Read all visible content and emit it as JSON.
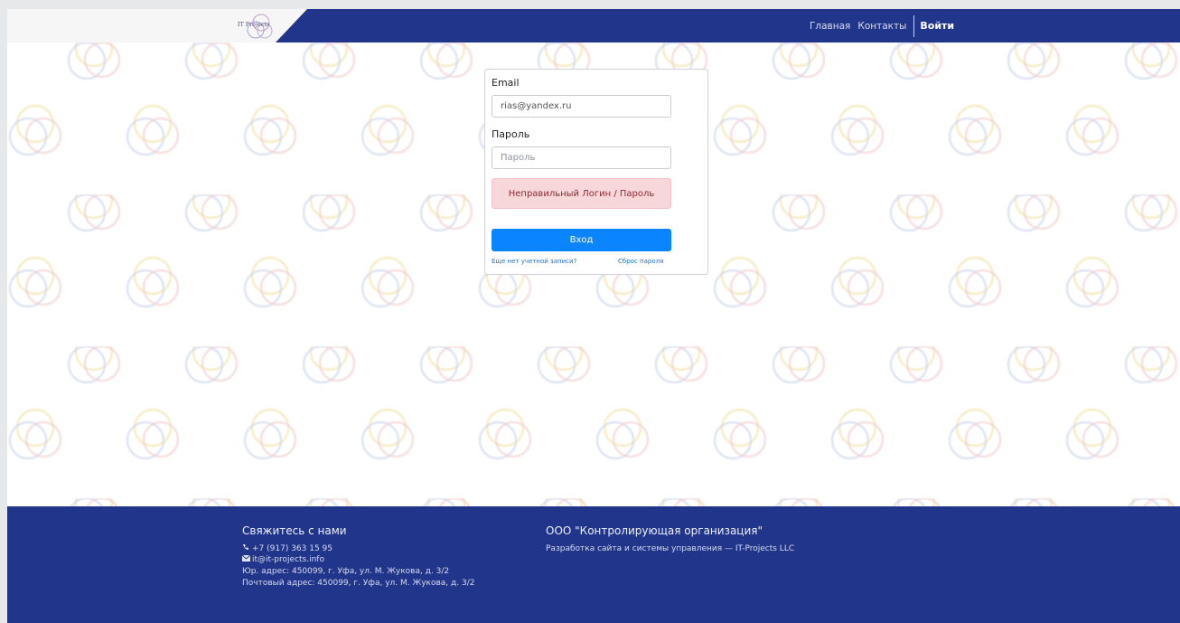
{
  "header": {
    "logo_text": "IT Projects",
    "nav": {
      "home": "Главная",
      "contacts": "Контакты",
      "login": "Войти"
    }
  },
  "login_form": {
    "email_label": "Email",
    "email_value": "rias@yandex.ru",
    "password_label": "Пароль",
    "password_placeholder": "Пароль",
    "error_message": "Неправильный Логин / Пароль",
    "submit_label": "Вход",
    "register_link": "Еще нет учетной записи?",
    "reset_link": "Сброс пароля"
  },
  "footer": {
    "contact_title": "Свяжитесь с нами",
    "phone": "+7 (917) 363 15 95",
    "email": "it@it-projects.info",
    "legal_address": "Юр. адрес: 450099, г. Уфа, ул. М. Жукова, д. 3/2",
    "postal_address": "Почтовый адрес: 450099, г. Уфа, ул. М. Жукова, д. 3/2",
    "org_title": "ООО \"Контролирующая организация\"",
    "dev_credit": "Разработка сайта и системы управления — IT-Projects LLC"
  },
  "colors": {
    "brand_navy": "#21358a",
    "primary_button": "#0a84ff",
    "error_bg": "#f8d7da"
  },
  "icons": {
    "phone": "phone-icon",
    "mail": "mail-icon"
  }
}
